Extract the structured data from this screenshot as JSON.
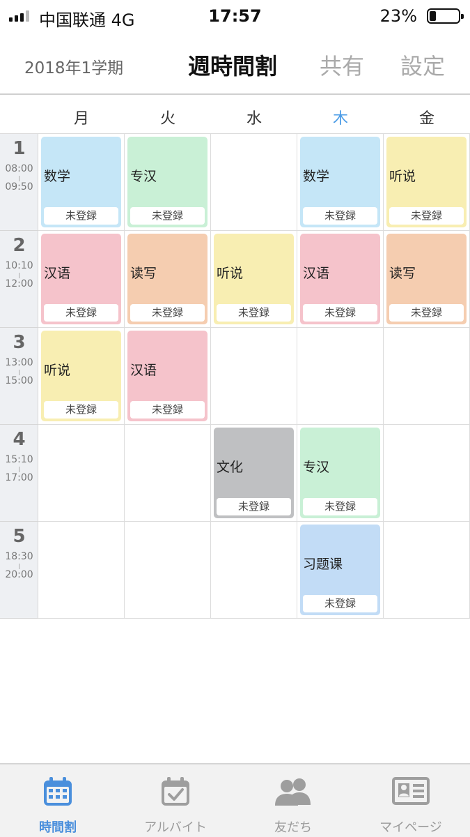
{
  "status_bar": {
    "carrier": "中国联通   4G",
    "time": "17:57",
    "battery": "23%"
  },
  "header": {
    "term": "2018年1学期",
    "title": "週時間割",
    "share": "共有",
    "settings": "設定"
  },
  "days": [
    "月",
    "火",
    "水",
    "木",
    "金"
  ],
  "today_index": 3,
  "periods": [
    {
      "number": "1",
      "start": "08:00",
      "end": "09:50"
    },
    {
      "number": "2",
      "start": "10:10",
      "end": "12:00"
    },
    {
      "number": "3",
      "start": "13:00",
      "end": "15:00"
    },
    {
      "number": "4",
      "start": "15:10",
      "end": "17:00"
    },
    {
      "number": "5",
      "start": "18:30",
      "end": "20:00"
    }
  ],
  "register_label": "未登録",
  "timetable": [
    [
      {
        "name": "数学",
        "color": "#c5e6f7"
      },
      {
        "name": "专汉",
        "color": "#c9f0d6"
      },
      null,
      {
        "name": "数学",
        "color": "#c5e6f7"
      },
      {
        "name": "听说",
        "color": "#f8eeb2"
      }
    ],
    [
      {
        "name": "汉语",
        "color": "#f5c3cb"
      },
      {
        "name": "读写",
        "color": "#f5cdb0"
      },
      {
        "name": "听说",
        "color": "#f8eeb2"
      },
      {
        "name": "汉语",
        "color": "#f5c3cb"
      },
      {
        "name": "读写",
        "color": "#f5cdb0"
      }
    ],
    [
      {
        "name": "听说",
        "color": "#f8eeb2"
      },
      {
        "name": "汉语",
        "color": "#f5c3cb"
      },
      null,
      null,
      null
    ],
    [
      null,
      null,
      {
        "name": "文化",
        "color": "#bfc0c2"
      },
      {
        "name": "专汉",
        "color": "#c9f0d6"
      },
      null
    ],
    [
      null,
      null,
      null,
      {
        "name": "习题课",
        "color": "#c2dcf6"
      },
      null
    ]
  ],
  "tabs": [
    {
      "label": "時間割",
      "icon": "calendar-icon",
      "active": true
    },
    {
      "label": "アルバイト",
      "icon": "calendar-check-icon",
      "active": false
    },
    {
      "label": "友だち",
      "icon": "friends-icon",
      "active": false
    },
    {
      "label": "マイページ",
      "icon": "id-card-icon",
      "active": false
    }
  ],
  "colors": {
    "accent": "#4a8fdc",
    "today": "#4a9be6"
  }
}
